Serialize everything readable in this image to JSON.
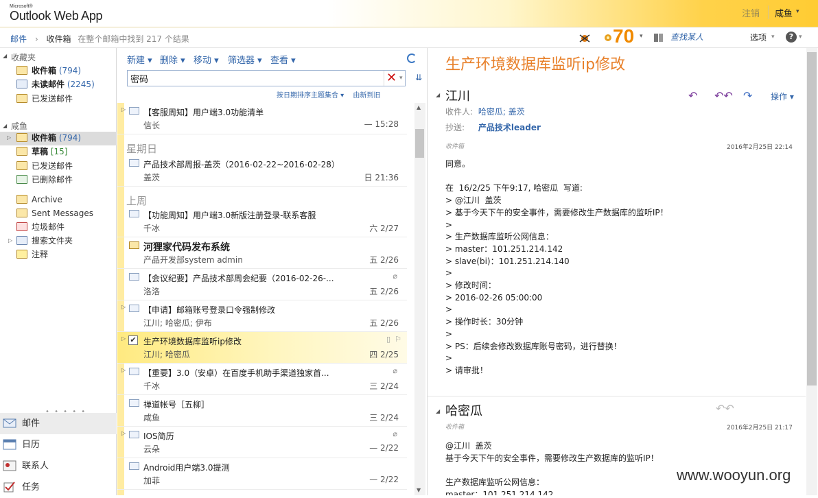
{
  "header": {
    "logo_small": "Microsoft®",
    "logo": "Outlook Web App",
    "signout": "注销",
    "user": "咸鱼"
  },
  "breadcrumb": {
    "root": "邮件",
    "folder": "收件箱",
    "result": "在整个邮箱中找到  217 个结果"
  },
  "topbar": {
    "points": "70",
    "find": "查找某人",
    "options": "选项",
    "help": "?"
  },
  "nav": {
    "favorites": "收藏夹",
    "fav_items": [
      {
        "label": "收件箱",
        "count": "(794)"
      },
      {
        "label": "未读邮件",
        "count": "(2245)"
      },
      {
        "label": "已发送邮件",
        "count": ""
      }
    ],
    "mailbox": "咸鱼",
    "box_items": [
      {
        "label": "收件箱",
        "count": "(794)"
      },
      {
        "label": "草稿",
        "count": "[15]"
      },
      {
        "label": "已发送邮件",
        "count": ""
      },
      {
        "label": "已删除邮件",
        "count": ""
      },
      {
        "label": "Archive",
        "count": ""
      },
      {
        "label": "Sent Messages",
        "count": ""
      },
      {
        "label": "垃圾邮件",
        "count": ""
      },
      {
        "label": "搜索文件夹",
        "count": ""
      },
      {
        "label": "注释",
        "count": ""
      }
    ],
    "modules": [
      "邮件",
      "日历",
      "联系人",
      "任务"
    ]
  },
  "toolbar": {
    "new": "新建 ▾",
    "delete": "删除 ▾",
    "move": "移动 ▾",
    "filter": "筛选器 ▾",
    "view": "查看 ▾"
  },
  "search": {
    "value": "密码"
  },
  "sort": {
    "by": "按日期排序主题集合 ▾",
    "order": "由新到旧"
  },
  "groups": {
    "g1": "星期日",
    "g2": "上周"
  },
  "messages": [
    {
      "subject": "【客服周知】用户端3.0功能清单",
      "from": "信长",
      "time": "— 15:28"
    },
    {
      "subject": "产品技术部周报-盖茨（2016-02-22~2016-02-28）",
      "from": "盖茨",
      "time": "日 21:36"
    },
    {
      "subject": "【功能周知】用户端3.0新版注册登录-联系客服",
      "from": "千冰",
      "time": "六 2/27"
    },
    {
      "subject": "河狸家代码发布系统",
      "from": "产品开发部system admin",
      "time": "五 2/26"
    },
    {
      "subject": "【会议纪要】产品技术部周会纪要（2016-02-26-...",
      "from": "洛洛",
      "time": "五 2/26"
    },
    {
      "subject": "【申请】邮箱账号登录口令强制修改",
      "from": "江川; 哈密瓜; 伊布",
      "time": "五 2/26"
    },
    {
      "subject": "生产环境数据库监听ip修改",
      "from": "江川; 哈密瓜",
      "time": "四 2/25"
    },
    {
      "subject": "【重要】3.0（安卓）在百度手机助手渠道独家首...",
      "from": "千冰",
      "time": "三 2/24"
    },
    {
      "subject": "禅道帐号［五柳］",
      "from": "咸鱼",
      "time": "三 2/24"
    },
    {
      "subject": "IOS简历",
      "from": "云朵",
      "time": "— 2/22"
    },
    {
      "subject": "Android用户端3.0提测",
      "from": "加菲",
      "time": "— 2/22"
    }
  ],
  "reading": {
    "title": "生产环境数据库监听ip修改",
    "sender1": "江川",
    "to_label": "收件人:",
    "to_value": "哈密瓜; 盖茨",
    "cc_label": "抄送:",
    "cc_value": "产品技术leader",
    "folder1": "收件箱",
    "date1": "2016年2月25日    22:14",
    "actions": "操作 ▾",
    "body1": "同意。\n\n在  16/2/25 下午9:17, 哈密瓜  写道:\n> @江川  盖茨\n> 基于今天下午的安全事件，需要修改生产数据库的监听IP！\n>\n> 生产数据库监听公网信息：\n> master：101.251.214.142\n> slave(bi)：101.251.214.140\n>\n> 修改时间：\n> 2016-02-26 05:00:00\n>\n> 操作时长：30分钟\n>\n> PS：后续会修改数据库账号密码，进行替换！\n>\n> 请审批！",
    "sender2": "哈密瓜",
    "folder2": "收件箱",
    "date2": "2016年2月25日    21:17",
    "body2": "@江川  盖茨\n基于今天下午的安全事件，需要修改生产数据库的监听IP！\n\n生产数据库监听公网信息：\nmaster：101.251.214.142"
  },
  "watermark": "www.wooyun.org"
}
